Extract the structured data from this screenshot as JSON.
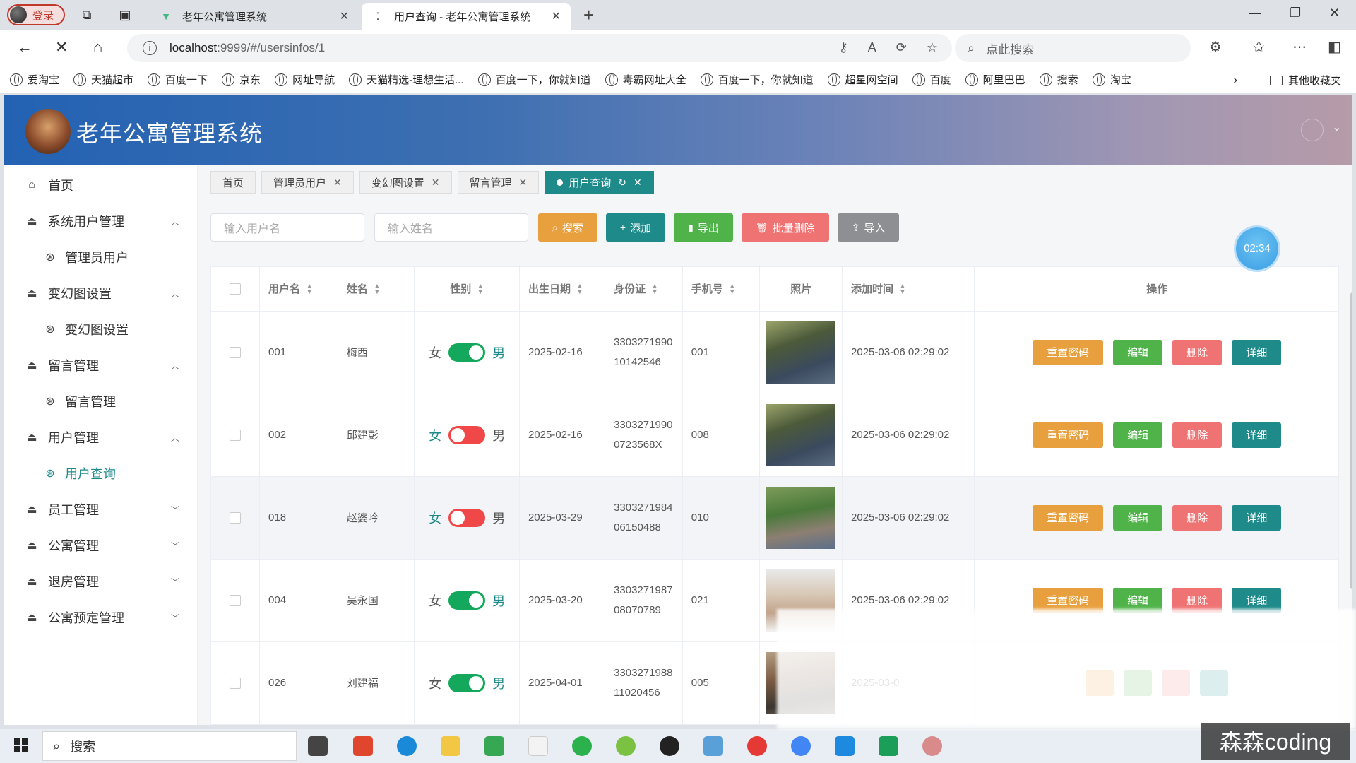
{
  "browser": {
    "profile_label": "登录",
    "tabs": [
      {
        "title": "老年公寓管理系统"
      },
      {
        "title": "用户查询 - 老年公寓管理系统"
      }
    ],
    "url_host": "localhost",
    "url_path": ":9999/#/usersinfos/1",
    "search_placeholder": "点此搜索",
    "bookmarks": [
      "爱淘宝",
      "天猫超市",
      "百度一下",
      "京东",
      "网址导航",
      "天猫精选-理想生活...",
      "百度一下，你就知道",
      "毒霸网址大全",
      "百度一下，你就知道",
      "超星网空间",
      "百度",
      "阿里巴巴",
      "搜索",
      "淘宝"
    ],
    "other_bookmarks": "其他收藏夹"
  },
  "app": {
    "title": "老年公寓管理系统",
    "timer": "02:34"
  },
  "sidebar": {
    "home": "首页",
    "groups": [
      {
        "label": "系统用户管理",
        "sub": "管理员用户",
        "expanded": true
      },
      {
        "label": "变幻图设置",
        "sub": "变幻图设置",
        "expanded": true
      },
      {
        "label": "留言管理",
        "sub": "留言管理",
        "expanded": true
      },
      {
        "label": "用户管理",
        "sub": "用户查询",
        "expanded": true
      },
      {
        "label": "员工管理",
        "expanded": false
      },
      {
        "label": "公寓管理",
        "expanded": false
      },
      {
        "label": "退房管理",
        "expanded": false
      },
      {
        "label": "公寓预定管理",
        "expanded": false
      }
    ]
  },
  "tags": [
    "首页",
    "管理员用户",
    "变幻图设置",
    "留言管理",
    "用户查询"
  ],
  "search": {
    "username_placeholder": "输入用户名",
    "name_placeholder": "输入姓名",
    "search_label": "搜索",
    "add_label": "添加",
    "export_label": "导出",
    "batch_delete_label": "批量删除",
    "import_label": "导入"
  },
  "table": {
    "headers": [
      "用户名",
      "姓名",
      "性别",
      "出生日期",
      "身份证",
      "手机号",
      "照片",
      "添加时间",
      "操作"
    ],
    "gender_female": "女",
    "gender_male": "男",
    "rows": [
      {
        "username": "001",
        "name": "梅西",
        "gender": "男",
        "birth": "2025-02-16",
        "id1": "3303271990",
        "id2": "10142546",
        "phone": "001",
        "added": "2025-03-06 02:29:02"
      },
      {
        "username": "002",
        "name": "邱建彭",
        "gender": "女",
        "birth": "2025-02-16",
        "id1": "3303271990",
        "id2": "0723568X",
        "phone": "008",
        "added": "2025-03-06 02:29:02"
      },
      {
        "username": "018",
        "name": "赵婆吟",
        "gender": "女",
        "birth": "2025-03-29",
        "id1": "3303271984",
        "id2": "06150488",
        "phone": "010",
        "added": "2025-03-06 02:29:02"
      },
      {
        "username": "004",
        "name": "吴永国",
        "gender": "男",
        "birth": "2025-03-20",
        "id1": "3303271987",
        "id2": "08070789",
        "phone": "021",
        "added": "2025-03-06 02:29:02"
      },
      {
        "username": "026",
        "name": "刘建福",
        "gender": "男",
        "birth": "2025-04-01",
        "id1": "3303271988",
        "id2": "11020456",
        "phone": "005",
        "added": "2025-03-0"
      }
    ],
    "ops": {
      "reset": "重置密码",
      "edit": "编辑",
      "delete": "删除",
      "detail": "详细"
    }
  },
  "taskbar": {
    "search_label": "搜索",
    "watermark": "森森coding"
  },
  "colors": {
    "primary": "#1e8a8a",
    "warning": "#e8a03f",
    "success": "#4fb34a",
    "danger": "#ef7373",
    "info": "#8d8f92"
  }
}
